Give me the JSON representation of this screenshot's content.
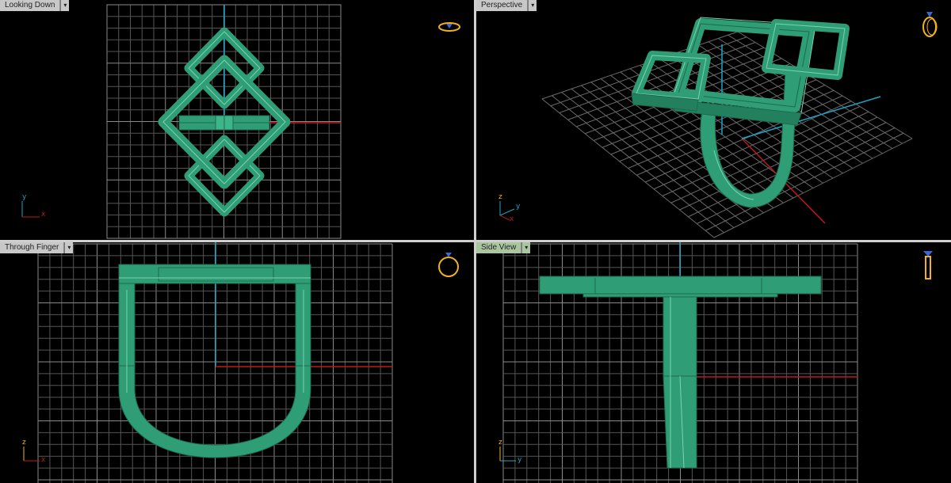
{
  "viewports": {
    "top_left": {
      "label": "Looking Down",
      "axis_a": "y",
      "axis_b": "x",
      "icon": "ring-top-icon"
    },
    "top_right": {
      "label": "Perspective",
      "axis_a": "z",
      "axis_b": "y",
      "axis_c": "x",
      "icon": "ring-perspective-icon"
    },
    "bottom_left": {
      "label": "Through Finger",
      "axis_a": "z",
      "axis_b": "x",
      "icon": "ring-front-icon"
    },
    "bottom_right": {
      "label": "Side View",
      "axis_a": "z",
      "axis_b": "y",
      "icon": "ring-side-icon"
    }
  },
  "colors": {
    "model_fill": "#2f9e77",
    "model_edge": "#1c6a4e",
    "grid": "#6a6a6a",
    "axis_red": "#c01818",
    "axis_cyan": "#1aa6c8",
    "icon_gold": "#f2b21b",
    "icon_blue": "#3a66d6",
    "label_bg": "#c8c8c8",
    "active_label_bg": "#a9c6a1"
  }
}
